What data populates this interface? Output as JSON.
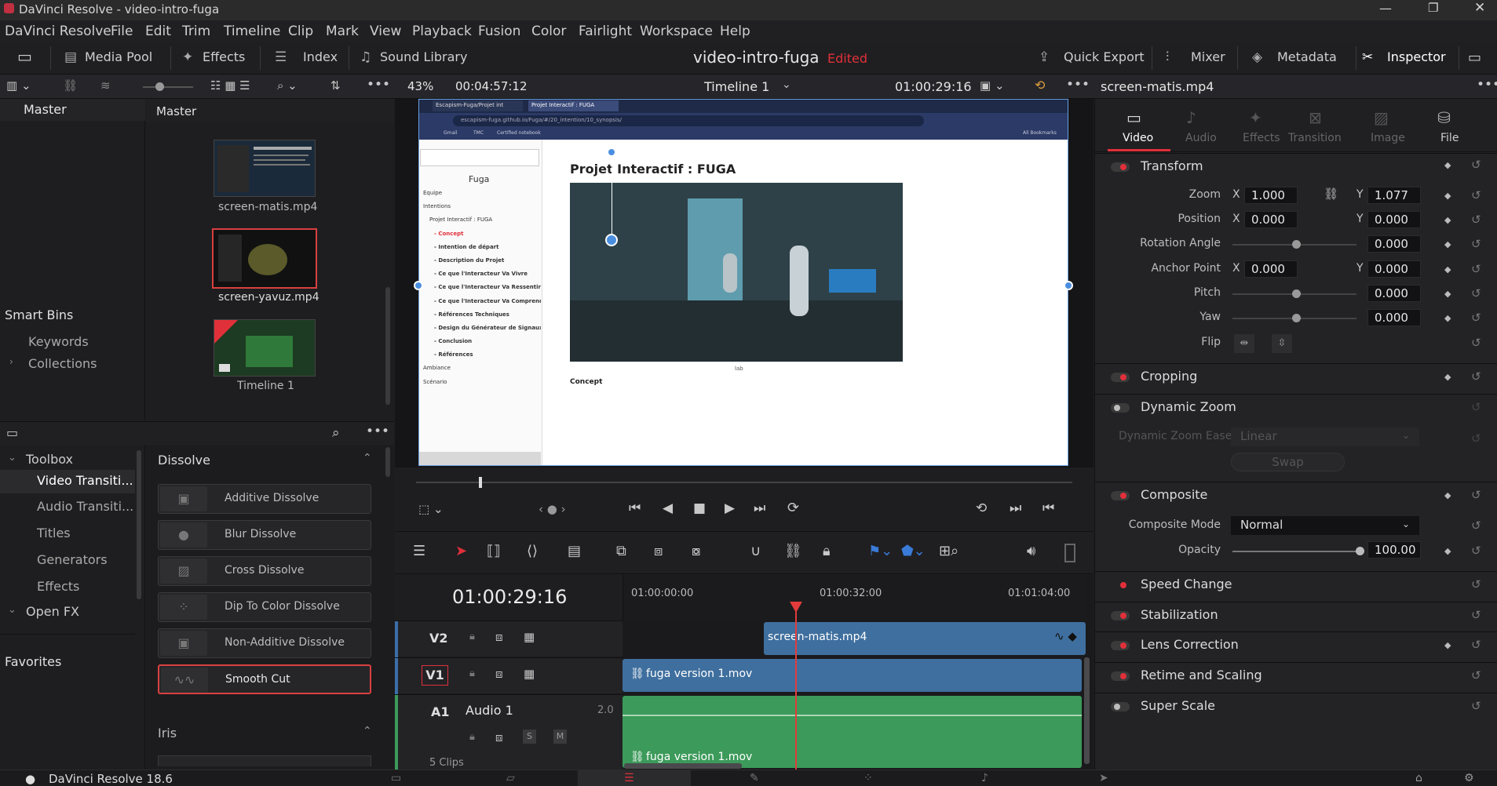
{
  "app": {
    "title": "DaVinci Resolve - video-intro-fuga",
    "version": "DaVinci Resolve 18.6"
  },
  "menu": [
    "DaVinci Resolve",
    "File",
    "Edit",
    "Trim",
    "Timeline",
    "Clip",
    "Mark",
    "View",
    "Playback",
    "Fusion",
    "Color",
    "Fairlight",
    "Workspace",
    "Help"
  ],
  "toolbar": {
    "media_pool": "Media Pool",
    "effects": "Effects",
    "index": "Index",
    "sound_library": "Sound Library",
    "project": "video-intro-fuga",
    "status": "Edited",
    "quick_export": "Quick Export",
    "mixer": "Mixer",
    "metadata": "Metadata",
    "inspector": "Inspector"
  },
  "viewer": {
    "zoom": "43%",
    "duration": "00:04:57:12",
    "timeline": "Timeline 1",
    "timecode": "01:00:29:16"
  },
  "media_pool": {
    "master": "Master",
    "master2": "Master",
    "clips": [
      "screen-matis.mp4",
      "screen-yavuz.mp4",
      "Timeline 1"
    ],
    "smart_bins": "Smart Bins",
    "keywords": "Keywords",
    "collections": "Collections"
  },
  "effects": {
    "toolbox": "Toolbox",
    "items": [
      "Video Transiti...",
      "Audio Transiti...",
      "Titles",
      "Generators",
      "Effects"
    ],
    "open_fx": "Open FX",
    "favorites": "Favorites",
    "group": "Dissolve",
    "dissolves": [
      "Additive Dissolve",
      "Blur Dissolve",
      "Cross Dissolve",
      "Dip To Color Dissolve",
      "Non-Additive Dissolve",
      "Smooth Cut"
    ],
    "iris": "Iris"
  },
  "browser": {
    "url": "escapism-fuga.github.io/Fuga/#/20_intention/10_synopsis/",
    "tab1": "Escapism-Fuga/Projet int",
    "tab2": "Projet Interactif : FUGA",
    "gmail": "Gmail",
    "tmc": "TMC",
    "certified": "Certified notebook",
    "bookmarks": "All Bookmarks",
    "sidebar_title": "Fuga",
    "nav": [
      "Équipe",
      "Intentions",
      "Projet Interactif : FUGA",
      "- Concept",
      "- Intention de départ",
      "- Description du Projet",
      "- Ce que l'Interacteur Va Vivre",
      "- Ce que l'Interacteur Va Ressentir",
      "- Ce que l'Interacteur Va Comprendre",
      "- Références Techniques",
      "- Design du Générateur de Signaux...",
      "- Conclusion",
      "- Références",
      "Ambiance",
      "Scénario"
    ],
    "heading": "Projet Interactif : FUGA",
    "caption": "lab",
    "concept": "Concept"
  },
  "timeline": {
    "timecode": "01:00:29:16",
    "ruler": [
      "01:00:00:00",
      "01:00:32:00",
      "01:01:04:00"
    ],
    "v2": "V2",
    "v1": "V1",
    "a1": "A1",
    "audio_name": "Audio 1",
    "audio_ch": "2.0",
    "clip_v2": "screen-matis.mp4",
    "clip_v1": "fuga version 1.mov",
    "clip_a1": "fuga version 1.mov",
    "clips_count": "5 Clips",
    "s": "S",
    "m": "M"
  },
  "inspector": {
    "clip": "screen-matis.mp4",
    "tabs": [
      "Video",
      "Audio",
      "Effects",
      "Transition",
      "Image",
      "File"
    ],
    "transform": "Transform",
    "zoom": "Zoom",
    "zoom_x": "1.000",
    "zoom_y": "1.077",
    "position": "Position",
    "pos_x": "0.000",
    "pos_y": "0.000",
    "rotation": "Rotation Angle",
    "rotation_val": "0.000",
    "anchor": "Anchor Point",
    "anchor_x": "0.000",
    "anchor_y": "0.000",
    "pitch": "Pitch",
    "pitch_val": "0.000",
    "yaw": "Yaw",
    "yaw_val": "0.000",
    "flip": "Flip",
    "x": "X",
    "y": "Y",
    "cropping": "Cropping",
    "dynamic_zoom": "Dynamic Zoom",
    "dz_ease": "Dynamic Zoom Ease",
    "dz_ease_val": "Linear",
    "swap": "Swap",
    "composite": "Composite",
    "composite_mode": "Composite Mode",
    "composite_mode_val": "Normal",
    "opacity": "Opacity",
    "opacity_val": "100.00",
    "speed_change": "Speed Change",
    "stabilization": "Stabilization",
    "lens_correction": "Lens Correction",
    "retime": "Retime and Scaling",
    "super_scale": "Super Scale"
  },
  "colors": {
    "accent_red": "#e0303a",
    "video_clip": "#3f6f9e",
    "audio_clip": "#3c9a5a",
    "playhead": "#e23b3b"
  }
}
